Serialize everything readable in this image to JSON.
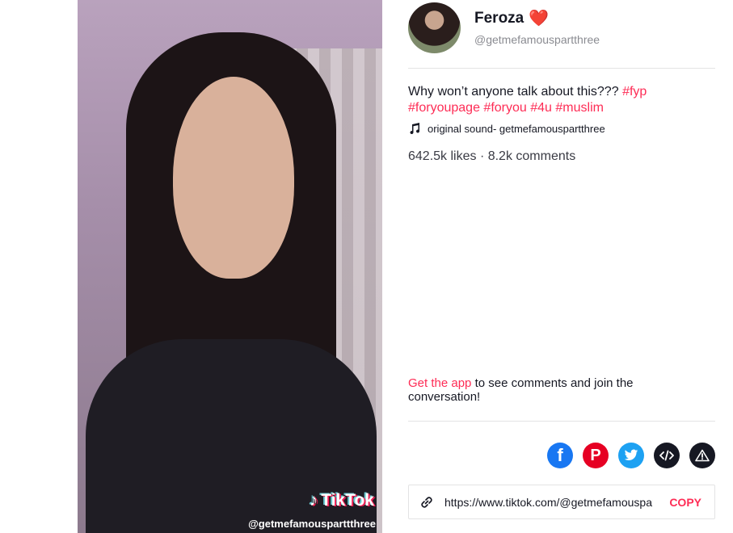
{
  "video": {
    "watermark_brand": "TikTok",
    "watermark_user": "@getmefamousparttthree"
  },
  "author": {
    "nickname": "Feroza",
    "nickname_emoji": "❤️",
    "username": "@getmefamouspartthree"
  },
  "caption": {
    "text": "Why won’t anyone talk about this???",
    "hashtags": [
      "#fyp",
      "#foryoupage",
      "#foryou",
      "#4u",
      "#muslim"
    ]
  },
  "music": {
    "icon": "music-note-icon",
    "label": "original sound- getmefamouspartthree"
  },
  "stats": {
    "text": "642.5k likes · 8.2k comments"
  },
  "get_app": {
    "link_label": "Get the app",
    "rest": " to see comments and join the conversation!"
  },
  "share": {
    "icons": [
      "facebook-icon",
      "pinterest-icon",
      "twitter-icon",
      "embed-icon",
      "report-icon"
    ],
    "url": "https://www.tiktok.com/@getmefamouspartthree",
    "copy_label": "COPY"
  },
  "colors": {
    "accent": "#fe2c55",
    "text": "#161823",
    "muted": "#8a8b91"
  }
}
